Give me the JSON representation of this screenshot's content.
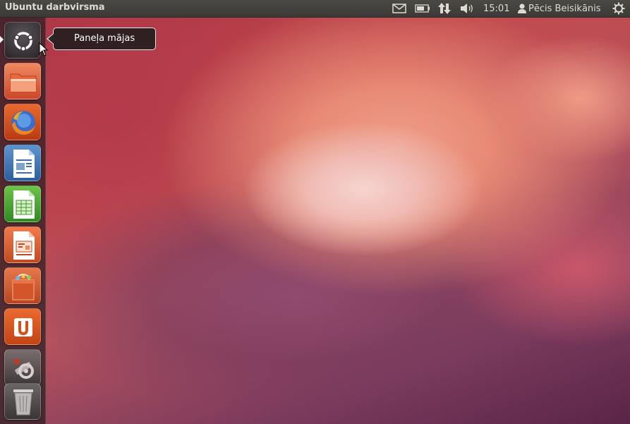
{
  "top_panel": {
    "window_title": "Ubuntu darbvirsma",
    "clock": "15:01",
    "user_name": "Pēcis Beisikānis",
    "icons": [
      "mail-icon",
      "battery-icon",
      "network-icon",
      "volume-icon",
      "user-icon",
      "session-gear-icon"
    ]
  },
  "launcher": {
    "items": [
      {
        "name": "dash-home",
        "icon": "ubuntu-logo-icon"
      },
      {
        "name": "home-folder",
        "icon": "folder-icon"
      },
      {
        "name": "firefox",
        "icon": "firefox-icon"
      },
      {
        "name": "libreoffice-writer",
        "icon": "writer-icon"
      },
      {
        "name": "libreoffice-calc",
        "icon": "calc-icon"
      },
      {
        "name": "libreoffice-impress",
        "icon": "impress-icon"
      },
      {
        "name": "software-center",
        "icon": "shopping-bag-icon"
      },
      {
        "name": "ubuntu-one",
        "icon": "ubuntu-one-icon"
      },
      {
        "name": "system-settings",
        "icon": "settings-icon"
      },
      {
        "name": "trash",
        "icon": "trash-icon"
      }
    ]
  },
  "tooltip": {
    "text": "Paneļa mājas"
  },
  "colors": {
    "panel": "#3c3b37",
    "launcher_bg": "#2a1e23",
    "accent": "#dd4814"
  }
}
